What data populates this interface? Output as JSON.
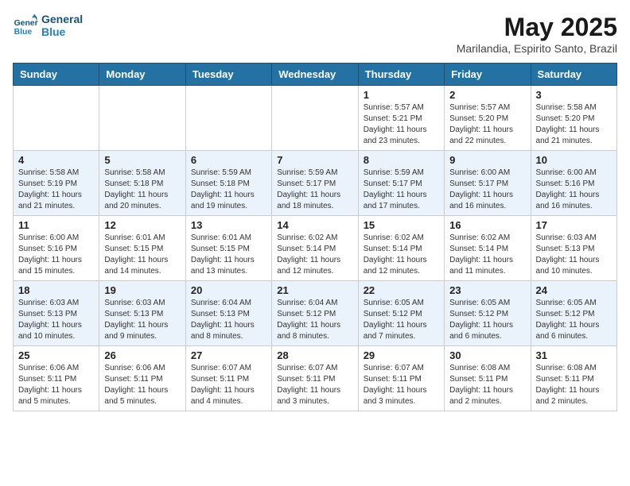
{
  "header": {
    "logo_line1": "General",
    "logo_line2": "Blue",
    "month_title": "May 2025",
    "location": "Marilandia, Espirito Santo, Brazil"
  },
  "days_of_week": [
    "Sunday",
    "Monday",
    "Tuesday",
    "Wednesday",
    "Thursday",
    "Friday",
    "Saturday"
  ],
  "weeks": [
    [
      {
        "day": "",
        "info": ""
      },
      {
        "day": "",
        "info": ""
      },
      {
        "day": "",
        "info": ""
      },
      {
        "day": "",
        "info": ""
      },
      {
        "day": "1",
        "info": "Sunrise: 5:57 AM\nSunset: 5:21 PM\nDaylight: 11 hours\nand 23 minutes."
      },
      {
        "day": "2",
        "info": "Sunrise: 5:57 AM\nSunset: 5:20 PM\nDaylight: 11 hours\nand 22 minutes."
      },
      {
        "day": "3",
        "info": "Sunrise: 5:58 AM\nSunset: 5:20 PM\nDaylight: 11 hours\nand 21 minutes."
      }
    ],
    [
      {
        "day": "4",
        "info": "Sunrise: 5:58 AM\nSunset: 5:19 PM\nDaylight: 11 hours\nand 21 minutes."
      },
      {
        "day": "5",
        "info": "Sunrise: 5:58 AM\nSunset: 5:18 PM\nDaylight: 11 hours\nand 20 minutes."
      },
      {
        "day": "6",
        "info": "Sunrise: 5:59 AM\nSunset: 5:18 PM\nDaylight: 11 hours\nand 19 minutes."
      },
      {
        "day": "7",
        "info": "Sunrise: 5:59 AM\nSunset: 5:17 PM\nDaylight: 11 hours\nand 18 minutes."
      },
      {
        "day": "8",
        "info": "Sunrise: 5:59 AM\nSunset: 5:17 PM\nDaylight: 11 hours\nand 17 minutes."
      },
      {
        "day": "9",
        "info": "Sunrise: 6:00 AM\nSunset: 5:17 PM\nDaylight: 11 hours\nand 16 minutes."
      },
      {
        "day": "10",
        "info": "Sunrise: 6:00 AM\nSunset: 5:16 PM\nDaylight: 11 hours\nand 16 minutes."
      }
    ],
    [
      {
        "day": "11",
        "info": "Sunrise: 6:00 AM\nSunset: 5:16 PM\nDaylight: 11 hours\nand 15 minutes."
      },
      {
        "day": "12",
        "info": "Sunrise: 6:01 AM\nSunset: 5:15 PM\nDaylight: 11 hours\nand 14 minutes."
      },
      {
        "day": "13",
        "info": "Sunrise: 6:01 AM\nSunset: 5:15 PM\nDaylight: 11 hours\nand 13 minutes."
      },
      {
        "day": "14",
        "info": "Sunrise: 6:02 AM\nSunset: 5:14 PM\nDaylight: 11 hours\nand 12 minutes."
      },
      {
        "day": "15",
        "info": "Sunrise: 6:02 AM\nSunset: 5:14 PM\nDaylight: 11 hours\nand 12 minutes."
      },
      {
        "day": "16",
        "info": "Sunrise: 6:02 AM\nSunset: 5:14 PM\nDaylight: 11 hours\nand 11 minutes."
      },
      {
        "day": "17",
        "info": "Sunrise: 6:03 AM\nSunset: 5:13 PM\nDaylight: 11 hours\nand 10 minutes."
      }
    ],
    [
      {
        "day": "18",
        "info": "Sunrise: 6:03 AM\nSunset: 5:13 PM\nDaylight: 11 hours\nand 10 minutes."
      },
      {
        "day": "19",
        "info": "Sunrise: 6:03 AM\nSunset: 5:13 PM\nDaylight: 11 hours\nand 9 minutes."
      },
      {
        "day": "20",
        "info": "Sunrise: 6:04 AM\nSunset: 5:13 PM\nDaylight: 11 hours\nand 8 minutes."
      },
      {
        "day": "21",
        "info": "Sunrise: 6:04 AM\nSunset: 5:12 PM\nDaylight: 11 hours\nand 8 minutes."
      },
      {
        "day": "22",
        "info": "Sunrise: 6:05 AM\nSunset: 5:12 PM\nDaylight: 11 hours\nand 7 minutes."
      },
      {
        "day": "23",
        "info": "Sunrise: 6:05 AM\nSunset: 5:12 PM\nDaylight: 11 hours\nand 6 minutes."
      },
      {
        "day": "24",
        "info": "Sunrise: 6:05 AM\nSunset: 5:12 PM\nDaylight: 11 hours\nand 6 minutes."
      }
    ],
    [
      {
        "day": "25",
        "info": "Sunrise: 6:06 AM\nSunset: 5:11 PM\nDaylight: 11 hours\nand 5 minutes."
      },
      {
        "day": "26",
        "info": "Sunrise: 6:06 AM\nSunset: 5:11 PM\nDaylight: 11 hours\nand 5 minutes."
      },
      {
        "day": "27",
        "info": "Sunrise: 6:07 AM\nSunset: 5:11 PM\nDaylight: 11 hours\nand 4 minutes."
      },
      {
        "day": "28",
        "info": "Sunrise: 6:07 AM\nSunset: 5:11 PM\nDaylight: 11 hours\nand 3 minutes."
      },
      {
        "day": "29",
        "info": "Sunrise: 6:07 AM\nSunset: 5:11 PM\nDaylight: 11 hours\nand 3 minutes."
      },
      {
        "day": "30",
        "info": "Sunrise: 6:08 AM\nSunset: 5:11 PM\nDaylight: 11 hours\nand 2 minutes."
      },
      {
        "day": "31",
        "info": "Sunrise: 6:08 AM\nSunset: 5:11 PM\nDaylight: 11 hours\nand 2 minutes."
      }
    ]
  ]
}
